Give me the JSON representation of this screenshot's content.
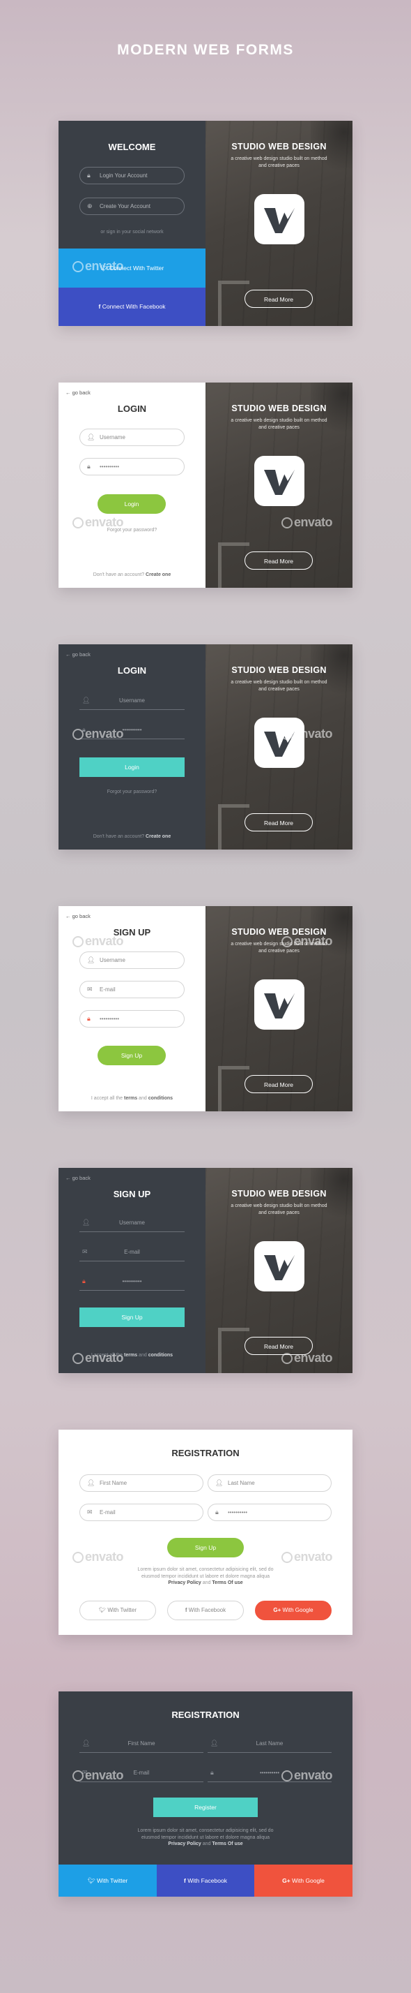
{
  "page_title": "MODERN WEB FORMS",
  "watermark": "envato",
  "right_panel": {
    "title": "STUDIO WEB DESIGN",
    "subtitle": "a creative web design studio built on method and creative paces",
    "read_more": "Read More"
  },
  "card1": {
    "title": "WELCOME",
    "login_account": "Login Your Account",
    "create_account": "Create Your Account",
    "or_social": "or sign in your social network",
    "twitter": "Connect With Twitter",
    "facebook": "Connect With Facebook"
  },
  "card2": {
    "go_back": "go back",
    "title": "LOGIN",
    "username_placeholder": "Username",
    "password_value": "••••••••••",
    "login_btn": "Login",
    "forgot": "Forgot your password?",
    "no_account": "Don't have an account?",
    "create_one": "Create one"
  },
  "card3": {
    "go_back": "go back",
    "title": "LOGIN",
    "username_placeholder": "Username",
    "password_value": "••••••••••",
    "login_btn": "Login",
    "forgot": "Forgot your password?",
    "no_account": "Don't have an account?",
    "create_one": "Create one"
  },
  "card4": {
    "go_back": "go back",
    "title": "SIGN UP",
    "username_placeholder": "Username",
    "email_placeholder": "E-mail",
    "password_value": "••••••••••",
    "signup_btn": "Sign Up",
    "accept_prefix": "I accept all the",
    "terms": "terms",
    "and": "and",
    "conditions": "conditions"
  },
  "card5": {
    "go_back": "go back",
    "title": "SIGN UP",
    "username_placeholder": "Username",
    "email_placeholder": "E-mail",
    "password_value": "••••••••••",
    "signup_btn": "Sign Up",
    "accept_prefix": "I accept all the",
    "terms": "terms",
    "and": "and",
    "conditions": "conditions"
  },
  "card6": {
    "title": "REGISTRATION",
    "first_name": "First Name",
    "last_name": "Last Name",
    "email": "E-mail",
    "password_value": "••••••••••",
    "signup_btn": "Sign Up",
    "lorem": "Lorem ipsum dolor sit amet, consectetur adipisicing elit, sed do eiusmod tempor incididunt ut labore et dolore magna aliqua",
    "policy": "Privacy Policy",
    "and": "and",
    "terms": "Terms Of use",
    "twitter": "With Twitter",
    "facebook": "With Facebook",
    "google": "With Google"
  },
  "card7": {
    "title": "REGISTRATION",
    "first_name": "First Name",
    "last_name": "Last Name",
    "email": "E-mail",
    "password_value": "••••••••••",
    "register_btn": "Register",
    "lorem": "Lorem ipsum dolor sit amet, consectetur adipisicing elit, sed do eiusmod tempor incididunt ut labore et dolore magna aliqua",
    "policy": "Privacy Policy",
    "and": "and",
    "terms": "Terms Of use",
    "twitter": "With Twitter",
    "facebook": "With Facebook",
    "google": "With Google"
  },
  "colors": {
    "dark_panel": "#3a3f46",
    "twitter": "#1d9fe6",
    "facebook": "#3d4fc4",
    "google": "#f0533d",
    "green": "#8cc63f",
    "teal": "#4fd1c5"
  }
}
